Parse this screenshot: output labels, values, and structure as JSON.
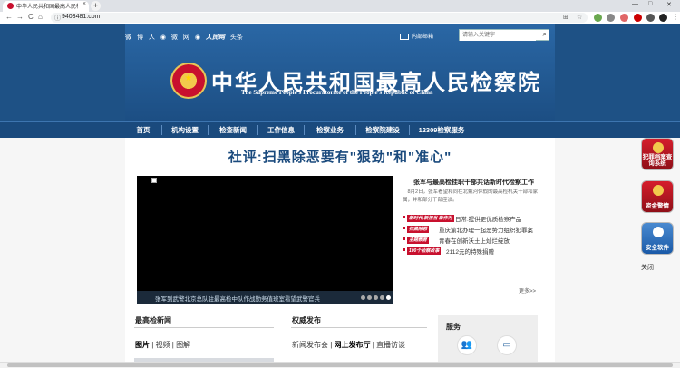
{
  "browser": {
    "tab_title": "中华人民共和国最高人民检察院",
    "tab_close": "×",
    "new_tab": "+",
    "url": "9403481.com",
    "nav_back": "←",
    "nav_forward": "→",
    "reload": "C",
    "home": "⌂",
    "window_min": "—",
    "window_max": "□",
    "window_close": "✕"
  },
  "header": {
    "social_items": [
      "微",
      "博",
      "人",
      "◉",
      "微",
      "网",
      "◉"
    ],
    "media_name": "人民网",
    "media_suffix": "头条",
    "mail_label": "内部邮箱",
    "search_placeholder": "请输入关键字",
    "title": "中华人民共和国最高人民检察院",
    "subtitle": "The Supreme People's Procuratorate of the People's Republic of China"
  },
  "nav": {
    "items": [
      "首页",
      "机构设置",
      "检查新闻",
      "工作信息",
      "检察业务",
      "检察院建设",
      "12309检察服务"
    ]
  },
  "main": {
    "headline": "社评:扫黑除恶要有\"狠劲\"和\"准心\"",
    "video_caption": "张军到武警北京总队驻最高检中队作战勤务值班室看望武警官兵",
    "feature_title": "张军与最高检挂职干部共话新时代检察工作",
    "feature_summary": "8月2日，张军看望和同在北戴河休假的最高检机关干部和家属，并和部分干部座谈。",
    "news": [
      {
        "tag": "新时代 新担当 新作为",
        "text": "日常:提供更优质检察产品"
      },
      {
        "tag": "扫黑除恶",
        "text": "重庆渝北办理一起恶势力组织犯罪案"
      },
      {
        "tag": "主题教育",
        "text": "青春在创新沃土上灿烂绽放"
      },
      {
        "tag": "100个检察故事",
        "text": "2112元的特殊捐赠"
      }
    ],
    "more": "更多>>"
  },
  "sections": {
    "news_title": "最高检新闻",
    "news_tabs": [
      "图片",
      "视频",
      "图解"
    ],
    "release_title": "权威发布",
    "release_tabs": [
      "新闻发布会",
      "网上发布厅",
      "直播访谈"
    ],
    "tab_separator": " | ",
    "service_title": "服务",
    "service_icons": [
      "users-icon",
      "monitor-icon"
    ]
  },
  "side": {
    "buttons": [
      {
        "label": "犯罪档案查询系统",
        "color": "red"
      },
      {
        "label": "资金警情",
        "color": "red"
      },
      {
        "label": "安全软件",
        "color": "blue"
      }
    ],
    "close_label": "关闭"
  },
  "colors": {
    "header_blue": "#1e5185",
    "nav_blue": "#1a4a7d",
    "accent_red": "#c8102e"
  }
}
